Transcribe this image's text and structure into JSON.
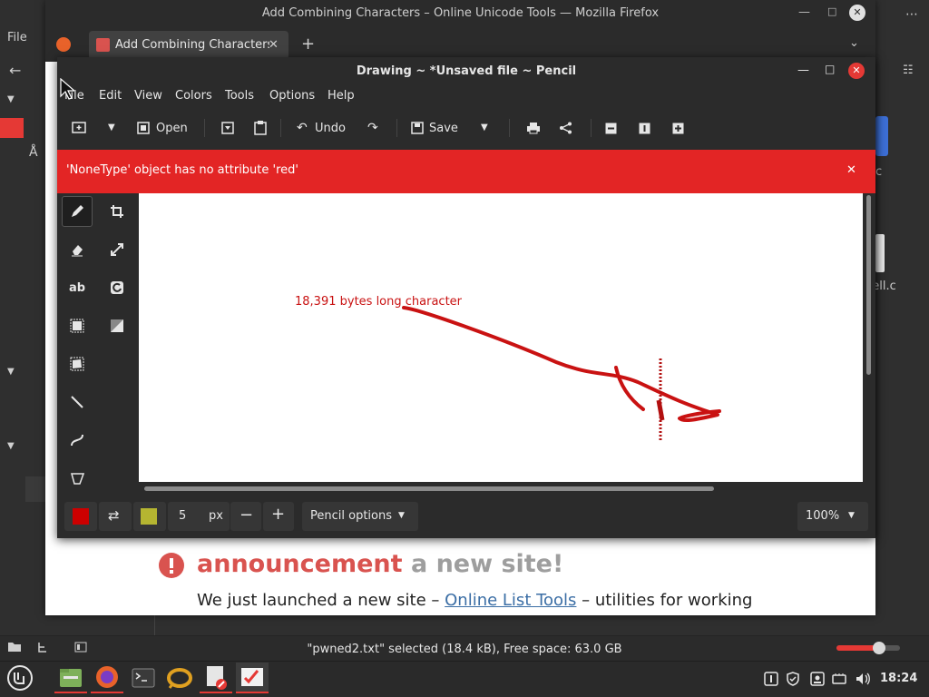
{
  "file_manager": {
    "menu_label": "File",
    "status": "\"pwned2.txt\" selected (18.4 kB), Free space: 63.0 GB",
    "right_label_1": "c",
    "right_label_2": "nell.c",
    "left_char": "Å"
  },
  "firefox": {
    "window_title": "Add Combining Characters – Online Unicode Tools — Mozilla Firefox",
    "tab_title": "Add Combining Characters",
    "new_tab_symbol": "+",
    "file_menu": "File",
    "page": {
      "announce_bold": "announcement",
      "announce_rest": "a new site!",
      "sub_before": "We just launched a new site – ",
      "sub_link": "Online List Tools",
      "sub_after": " – utilities for working"
    }
  },
  "pencil": {
    "window_title": "Drawing ~ *Unsaved file ~ Pencil",
    "menu": [
      "File",
      "Edit",
      "View",
      "Colors",
      "Tools",
      "Options",
      "Help"
    ],
    "toolbar": {
      "open": "Open",
      "undo": "Undo",
      "save": "Save"
    },
    "error": "'NoneType' object has no attribute 'red'",
    "canvas_label": "18,391 bytes long character",
    "size_value": "5",
    "size_unit": "px",
    "tool_options": "Pencil options",
    "zoom": "100%",
    "colors": {
      "main": "#cc0000",
      "secondary": "#b5b531",
      "error_bar": "#e32525"
    }
  },
  "taskbar": {
    "clock": "18:24"
  }
}
